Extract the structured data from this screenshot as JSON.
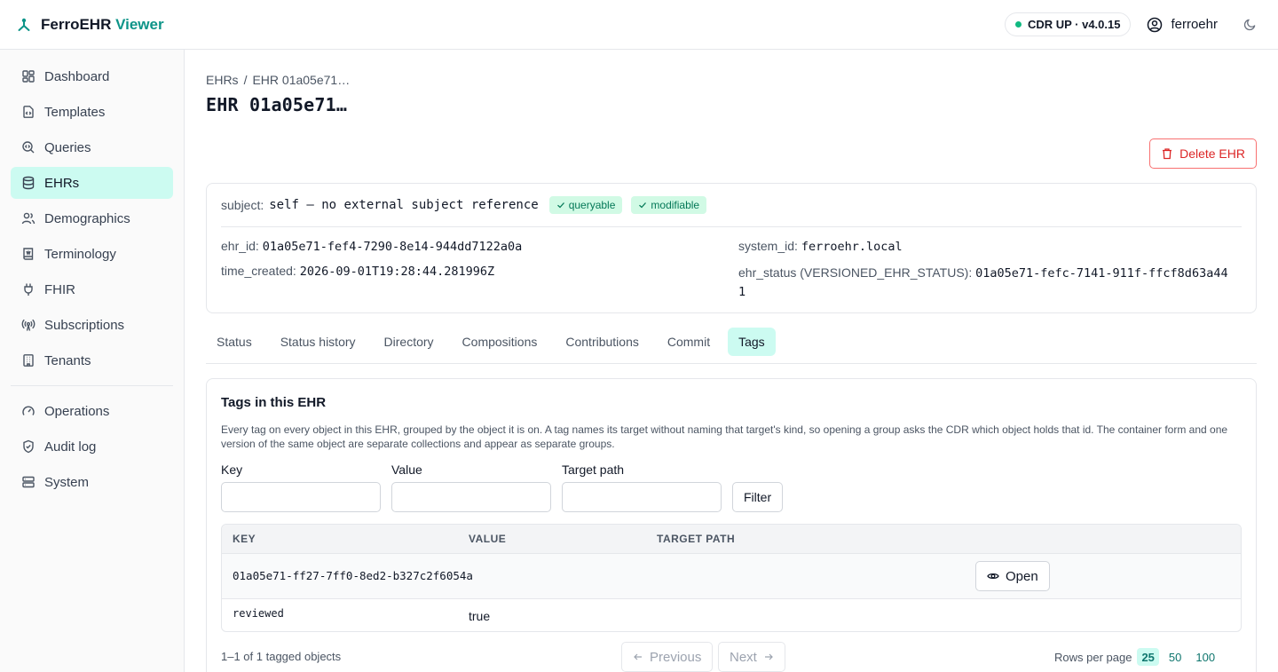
{
  "app": {
    "brand_name": "FerroEHR",
    "brand_suffix": "Viewer",
    "accent_color": "#0d9488",
    "status_text": "CDR UP · v4.0.15",
    "user_name": "ferroehr"
  },
  "sidebar": {
    "items": [
      {
        "label": "Dashboard",
        "icon": "dashboard-icon"
      },
      {
        "label": "Templates",
        "icon": "file-code-icon"
      },
      {
        "label": "Queries",
        "icon": "search-code-icon"
      },
      {
        "label": "EHRs",
        "icon": "database-icon",
        "active": true
      },
      {
        "label": "Demographics",
        "icon": "users-icon"
      },
      {
        "label": "Terminology",
        "icon": "book-icon"
      },
      {
        "label": "FHIR",
        "icon": "plug-icon"
      },
      {
        "label": "Subscriptions",
        "icon": "radio-icon"
      },
      {
        "label": "Tenants",
        "icon": "building-icon"
      },
      {
        "label": "Operations",
        "icon": "gauge-icon"
      },
      {
        "label": "Audit log",
        "icon": "shield-icon"
      },
      {
        "label": "System",
        "icon": "server-icon"
      }
    ]
  },
  "breadcrumb": {
    "root": "EHRs",
    "sep": "/",
    "current": "EHR 01a05e71…"
  },
  "page": {
    "title": "EHR 01a05e71…",
    "delete_label": "Delete EHR"
  },
  "ehr": {
    "subject_label": "subject:",
    "subject_value": "self — no external subject reference",
    "badges": [
      "queryable",
      "modifiable"
    ],
    "ehr_id_label": "ehr_id:",
    "ehr_id": "01a05e71-fef4-7290-8e14-944dd7122a0a",
    "time_created_label": "time_created:",
    "time_created": "2026-09-01T19:28:44.281996Z",
    "system_id_label": "system_id:",
    "system_id": "ferroehr.local",
    "ehr_status_label": "ehr_status (VERSIONED_EHR_STATUS):",
    "ehr_status_line1": "01a05e71-fefc-7141-911f-ffcf8d63a44",
    "ehr_status_line2": "1"
  },
  "tabs": [
    "Status",
    "Status history",
    "Directory",
    "Compositions",
    "Contributions",
    "Commit",
    "Tags"
  ],
  "active_tab": "Tags",
  "tags": {
    "title": "Tags in this EHR",
    "description": "Every tag on every object in this EHR, grouped by the object it is on. A tag names its target without naming that target's kind, so opening a group asks the CDR which object holds that id. The container form and one version of the same object are separate collections and appear as separate groups.",
    "filters": {
      "key_label": "Key",
      "key_value": "",
      "value_label": "Value",
      "value_value": "",
      "path_label": "Target path",
      "path_value": "",
      "filter_button": "Filter"
    },
    "columns": [
      "KEY",
      "VALUE",
      "TARGET PATH"
    ],
    "groups": [
      {
        "object_id": "01a05e71-ff27-7ff0-8ed2-b327c2f6054a",
        "open_label": "Open",
        "tags": [
          {
            "key": "reviewed",
            "value": "true",
            "path": ""
          }
        ]
      }
    ],
    "pager": {
      "count_text": "1–1 of 1 tagged objects",
      "previous": "Previous",
      "next": "Next",
      "rows_label": "Rows per page",
      "rows_options": [
        "25",
        "50",
        "100"
      ],
      "rows_selected": "25"
    }
  }
}
